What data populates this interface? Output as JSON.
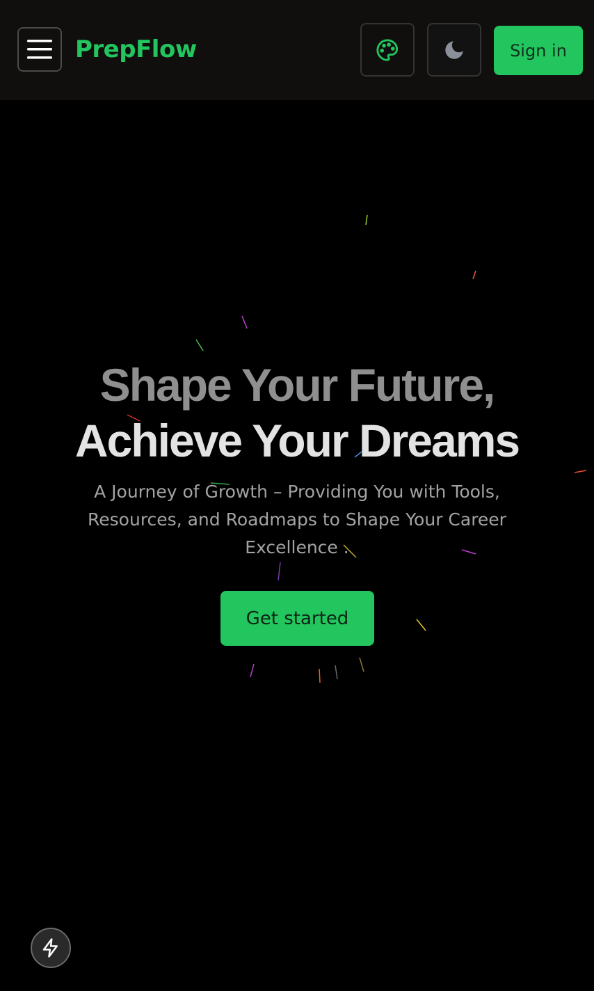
{
  "navbar": {
    "menu_icon": "hamburger-menu-icon",
    "brand": "PrepFlow",
    "theme_icon": "palette-icon",
    "mode_icon": "moon-icon",
    "signin_label": "Sign in"
  },
  "hero": {
    "title_line_1": "Shape Your Future,",
    "title_line_2": "Achieve Your Dreams",
    "subtitle": "A Journey of Growth – Providing You with Tools, Resources, and Roadmaps to Shape Your Career Excellence .",
    "cta_label": "Get started"
  },
  "floating_button": {
    "icon": "lightning-bolt-icon"
  },
  "colors": {
    "accent": "#22c55e",
    "background": "#000000",
    "navbar_background": "#110f0e"
  }
}
